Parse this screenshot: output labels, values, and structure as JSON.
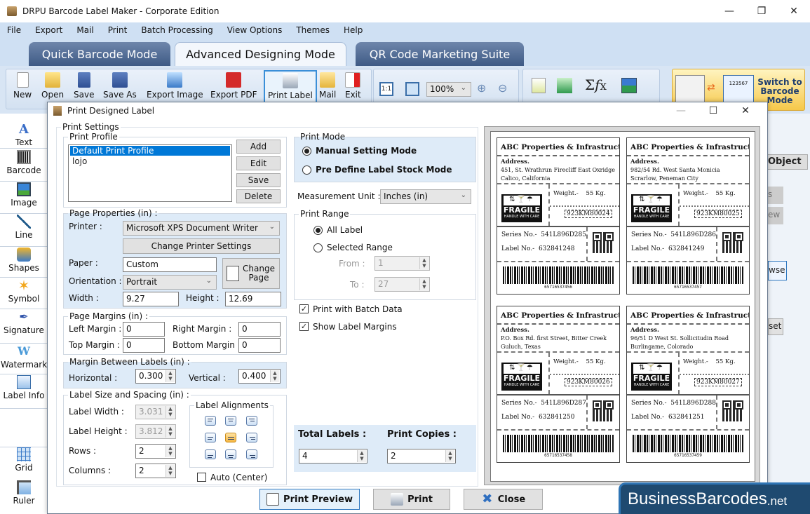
{
  "window": {
    "title": "DRPU Barcode Label Maker - Corporate Edition"
  },
  "menu": [
    "File",
    "Export",
    "Mail",
    "Print",
    "Batch Processing",
    "View Options",
    "Themes",
    "Help"
  ],
  "mode_tabs": [
    {
      "label": "Quick Barcode Mode",
      "active": false
    },
    {
      "label": "Advanced Designing Mode",
      "active": true
    },
    {
      "label": "QR Code Marketing Suite",
      "active": false
    }
  ],
  "toolbar": {
    "buttons": [
      "New",
      "Open",
      "Save",
      "Save As",
      "Export Image",
      "Export PDF",
      "Print Label",
      "Mail",
      "Exit"
    ],
    "selected": "Print Label",
    "zoom_value": "100%",
    "switch_label": "Switch to Barcode Mode",
    "switch_sample_number": "123567"
  },
  "left_tools": [
    "Text",
    "Barcode",
    "Image",
    "Line",
    "Shapes",
    "Symbol",
    "Signature",
    "Watermark",
    "Label Info",
    "Grid",
    "Ruler"
  ],
  "right_strip": {
    "object_tab": "Object",
    "partial_buttons": [
      "s",
      "ew",
      "wse",
      "set"
    ]
  },
  "dialog": {
    "title": "Print Designed Label",
    "print_settings_label": "Print Settings",
    "print_profile": {
      "legend": "Print Profile",
      "items": [
        "Default Print Profile",
        "lojo"
      ],
      "selected": "Default Print Profile",
      "buttons": [
        "Add",
        "Edit",
        "Save",
        "Delete"
      ]
    },
    "page_properties": {
      "legend": "Page Properties (in) :",
      "printer_label": "Printer :",
      "printer_value": "Microsoft XPS Document Writer",
      "change_printer_button": "Change Printer Settings",
      "paper_label": "Paper :",
      "paper_value": "Custom",
      "orientation_label": "Orientation :",
      "orientation_value": "Portrait",
      "change_page_button": "Change Page",
      "width_label": "Width :",
      "width_value": "9.27",
      "height_label": "Height :",
      "height_value": "12.69"
    },
    "page_margins": {
      "legend": "Page Margins (in) :",
      "left_label": "Left Margin :",
      "left_value": "0",
      "right_label": "Right Margin :",
      "right_value": "0",
      "top_label": "Top Margin :",
      "top_value": "0",
      "bottom_label": "Bottom Margin :",
      "bottom_value": "0"
    },
    "margin_between": {
      "legend": "Margin Between Labels (in) :",
      "horizontal_label": "Horizontal :",
      "horizontal_value": "0.300",
      "vertical_label": "Vertical :",
      "vertical_value": "0.400"
    },
    "label_size": {
      "legend": "Label Size and Spacing (in) :",
      "width_label": "Label Width :",
      "width_value": "3.031",
      "height_label": "Label Height :",
      "height_value": "3.812",
      "rows_label": "Rows :",
      "rows_value": "2",
      "columns_label": "Columns :",
      "columns_value": "2",
      "alignments_legend": "Label Alignments",
      "selected_alignment": "middle-center",
      "auto_center_label": "Auto (Center)",
      "auto_center_checked": false
    },
    "print_mode": {
      "legend": "Print Mode",
      "options": [
        "Manual Setting Mode",
        "Pre Define Label Stock Mode"
      ],
      "selected": "Manual Setting Mode"
    },
    "measurement_unit": {
      "label": "Measurement Unit :",
      "value": "Inches (in)"
    },
    "print_range": {
      "legend": "Print Range",
      "options": [
        "All Label",
        "Selected Range"
      ],
      "selected": "All Label",
      "from_label": "From :",
      "from_value": "1",
      "to_label": "To :",
      "to_value": "27"
    },
    "print_with_batch_data": {
      "label": "Print with Batch Data",
      "checked": true
    },
    "show_label_margins": {
      "label": "Show Label Margins",
      "checked": true
    },
    "total_labels": {
      "label": "Total Labels :",
      "value": "4"
    },
    "print_copies": {
      "label": "Print Copies :",
      "value": "2"
    },
    "buttons": {
      "preview": "Print Preview",
      "print": "Print",
      "close": "Close"
    }
  },
  "labels": [
    {
      "company": "ABC Properties & Infrastructure",
      "address_title": "Address.",
      "address_line1": "451, St. Wrathrun Firecliff East Oxridge",
      "address_line2": "Calico, California",
      "fragile": "FRAGILE",
      "fragile_sub": "HANDLE WITH CARE",
      "weight_label": "Weight.-",
      "weight_value": "55 Kg.",
      "code": "923KM80024",
      "series_label": "Series No.-",
      "series_value": "541L896D285",
      "label_no_label": "Label No.-",
      "label_no_value": "632841248",
      "barcode_number": "65716537456"
    },
    {
      "company": "ABC Properties & Infrastructure",
      "address_title": "Address.",
      "address_line1": "982/54 Rd. West Santa Monicia",
      "address_line2": "Scrarlow, Peneman City",
      "fragile": "FRAGILE",
      "fragile_sub": "HANDLE WITH CARE",
      "weight_label": "Weight.-",
      "weight_value": "55 Kg.",
      "code": "923KM80025",
      "series_label": "Series No.-",
      "series_value": "541L896D286",
      "label_no_label": "Label No.-",
      "label_no_value": "632841249",
      "barcode_number": "65716537457"
    },
    {
      "company": "ABC Properties & Infrastructure",
      "address_title": "Address.",
      "address_line1": "P.O. Box Rd. first Street, Bitter Creek",
      "address_line2": "Guluch, Texas",
      "fragile": "FRAGILE",
      "fragile_sub": "HANDLE WITH CARE",
      "weight_label": "Weight.-",
      "weight_value": "55 Kg.",
      "code": "923KM80026",
      "series_label": "Series No.-",
      "series_value": "541L896D287",
      "label_no_label": "Label No.-",
      "label_no_value": "632841250",
      "barcode_number": "65716537458"
    },
    {
      "company": "ABC Properties & Infrastructure",
      "address_title": "Address.",
      "address_line1": "96/51 D West St. Sollicitudin Road",
      "address_line2": "Burlingame, Colorado",
      "fragile": "FRAGILE",
      "fragile_sub": "HANDLE WITH CARE",
      "weight_label": "Weight.-",
      "weight_value": "55 Kg.",
      "code": "923KM80027",
      "series_label": "Series No.-",
      "series_value": "541L896D288",
      "label_no_label": "Label No.-",
      "label_no_value": "632841251",
      "barcode_number": "65716537459"
    }
  ],
  "watermark": {
    "brand": "BusinessBarcodes",
    "tld": ".net"
  }
}
